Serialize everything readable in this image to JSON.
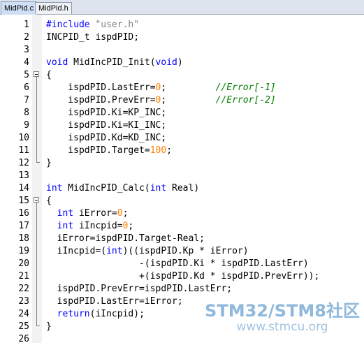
{
  "tabs": [
    {
      "label": "MidPid.c",
      "active": true
    },
    {
      "label": "MidPid.h",
      "active": false
    }
  ],
  "lines": [
    {
      "num": "1",
      "segs": [
        {
          "t": "#include ",
          "c": "kw"
        },
        {
          "t": "\"user.h\"",
          "c": "str"
        }
      ]
    },
    {
      "num": "2",
      "segs": [
        {
          "t": "INCPID_t ispdPID;",
          "c": ""
        }
      ]
    },
    {
      "num": "3",
      "segs": []
    },
    {
      "num": "4",
      "segs": [
        {
          "t": "void",
          "c": "kw"
        },
        {
          "t": " MidIncPID_Init(",
          "c": ""
        },
        {
          "t": "void",
          "c": "kw"
        },
        {
          "t": ")",
          "c": ""
        }
      ]
    },
    {
      "num": "5",
      "segs": [
        {
          "t": "{",
          "c": ""
        }
      ]
    },
    {
      "num": "6",
      "segs": [
        {
          "t": "    ispdPID.LastErr=",
          "c": ""
        },
        {
          "t": "0",
          "c": "num"
        },
        {
          "t": ";         ",
          "c": ""
        },
        {
          "t": "//Error[-1]",
          "c": "cmt"
        }
      ]
    },
    {
      "num": "7",
      "segs": [
        {
          "t": "    ispdPID.PrevErr=",
          "c": ""
        },
        {
          "t": "0",
          "c": "num"
        },
        {
          "t": ";         ",
          "c": ""
        },
        {
          "t": "//Error[-2]",
          "c": "cmt"
        }
      ]
    },
    {
      "num": "8",
      "segs": [
        {
          "t": "    ispdPID.Ki=KP_INC;",
          "c": ""
        }
      ]
    },
    {
      "num": "9",
      "segs": [
        {
          "t": "    ispdPID.Ki=KI_INC;",
          "c": ""
        }
      ]
    },
    {
      "num": "10",
      "segs": [
        {
          "t": "    ispdPID.Kd=KD_INC;",
          "c": ""
        }
      ]
    },
    {
      "num": "11",
      "segs": [
        {
          "t": "    ispdPID.Target=",
          "c": ""
        },
        {
          "t": "100",
          "c": "num"
        },
        {
          "t": ";",
          "c": ""
        }
      ]
    },
    {
      "num": "12",
      "segs": [
        {
          "t": "}",
          "c": ""
        }
      ]
    },
    {
      "num": "13",
      "segs": []
    },
    {
      "num": "14",
      "segs": [
        {
          "t": "int",
          "c": "kw"
        },
        {
          "t": " MidIncPID_Calc(",
          "c": ""
        },
        {
          "t": "int",
          "c": "kw"
        },
        {
          "t": " Real)",
          "c": ""
        }
      ]
    },
    {
      "num": "15",
      "segs": [
        {
          "t": "{",
          "c": ""
        }
      ]
    },
    {
      "num": "16",
      "segs": [
        {
          "t": "  ",
          "c": ""
        },
        {
          "t": "int",
          "c": "kw"
        },
        {
          "t": " iError=",
          "c": ""
        },
        {
          "t": "0",
          "c": "num"
        },
        {
          "t": ";",
          "c": ""
        }
      ]
    },
    {
      "num": "17",
      "segs": [
        {
          "t": "  ",
          "c": ""
        },
        {
          "t": "int",
          "c": "kw"
        },
        {
          "t": " iIncpid=",
          "c": ""
        },
        {
          "t": "0",
          "c": "num"
        },
        {
          "t": ";",
          "c": ""
        }
      ]
    },
    {
      "num": "18",
      "segs": [
        {
          "t": "  iError=ispdPID.Target-Real;",
          "c": ""
        }
      ]
    },
    {
      "num": "19",
      "segs": [
        {
          "t": "  iIncpid=(",
          "c": ""
        },
        {
          "t": "int",
          "c": "kw"
        },
        {
          "t": ")((ispdPID.Kp * iError)",
          "c": ""
        }
      ]
    },
    {
      "num": "20",
      "segs": [
        {
          "t": "                 -(ispdPID.Ki * ispdPID.LastErr)",
          "c": ""
        }
      ]
    },
    {
      "num": "21",
      "segs": [
        {
          "t": "                 +(ispdPID.Kd * ispdPID.PrevErr));",
          "c": ""
        }
      ]
    },
    {
      "num": "22",
      "segs": [
        {
          "t": "  ispdPID.PrevErr=ispdPID.LastErr;",
          "c": ""
        }
      ]
    },
    {
      "num": "23",
      "segs": [
        {
          "t": "  ispdPID.LastErr=iError;",
          "c": ""
        }
      ]
    },
    {
      "num": "24",
      "segs": [
        {
          "t": "  ",
          "c": ""
        },
        {
          "t": "return",
          "c": "kw"
        },
        {
          "t": "(iIncpid);",
          "c": ""
        }
      ]
    },
    {
      "num": "25",
      "segs": [
        {
          "t": "}",
          "c": ""
        }
      ]
    },
    {
      "num": "26",
      "segs": []
    }
  ],
  "watermark": {
    "line1": "STM32/STM8社区",
    "line2": "www.stmcu.org"
  }
}
